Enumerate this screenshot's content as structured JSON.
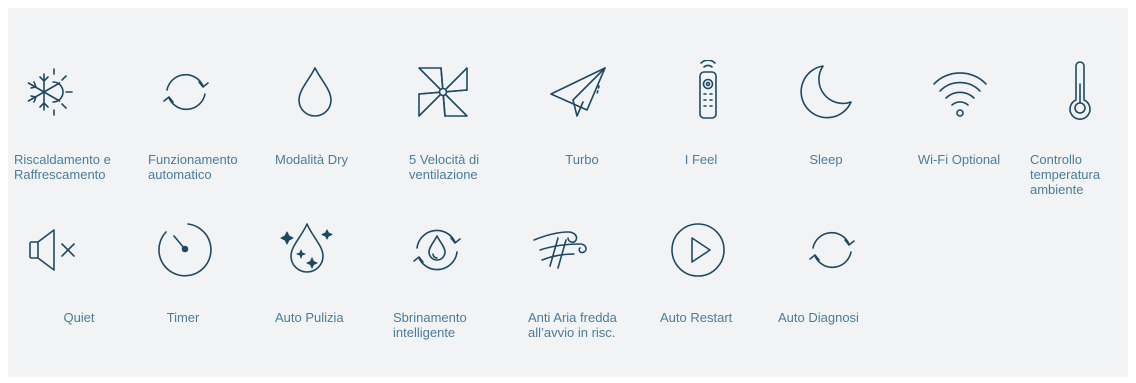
{
  "colors": {
    "icon_stroke": "#1d4a63",
    "label_text": "#4a7d9a",
    "panel_background": "#f2f3f4"
  },
  "features": [
    {
      "label": "Riscaldamento e Raffrescamento",
      "icon": "snowflake-sun-icon"
    },
    {
      "label": "Funzionamento automatico",
      "icon": "auto-cycle-icon"
    },
    {
      "label": "Modalità Dry",
      "icon": "water-drop-icon"
    },
    {
      "label": "5 Velocità di ventilazione",
      "icon": "pinwheel-fan-icon"
    },
    {
      "label": "Turbo",
      "icon": "paper-plane-icon"
    },
    {
      "label": "I Feel",
      "icon": "remote-control-icon"
    },
    {
      "label": "Sleep",
      "icon": "crescent-moon-icon"
    },
    {
      "label": "Wi-Fi Optional",
      "icon": "wifi-icon"
    },
    {
      "label": "Controllo temperatura ambiente",
      "icon": "thermometer-icon"
    },
    {
      "label": "Quiet",
      "icon": "speaker-mute-icon"
    },
    {
      "label": "Timer",
      "icon": "timer-icon"
    },
    {
      "label": "Auto Pulizia",
      "icon": "sparkling-drop-icon"
    },
    {
      "label": "Sbrinamento intelligente",
      "icon": "defrost-cycle-icon"
    },
    {
      "label": "Anti Aria fredda all’avvio in risc.",
      "icon": "wind-gust-icon"
    },
    {
      "label": "Auto Restart",
      "icon": "play-circle-icon"
    },
    {
      "label": "Auto Diagnosi",
      "icon": "auto-diagnosis-cycle-icon"
    }
  ]
}
